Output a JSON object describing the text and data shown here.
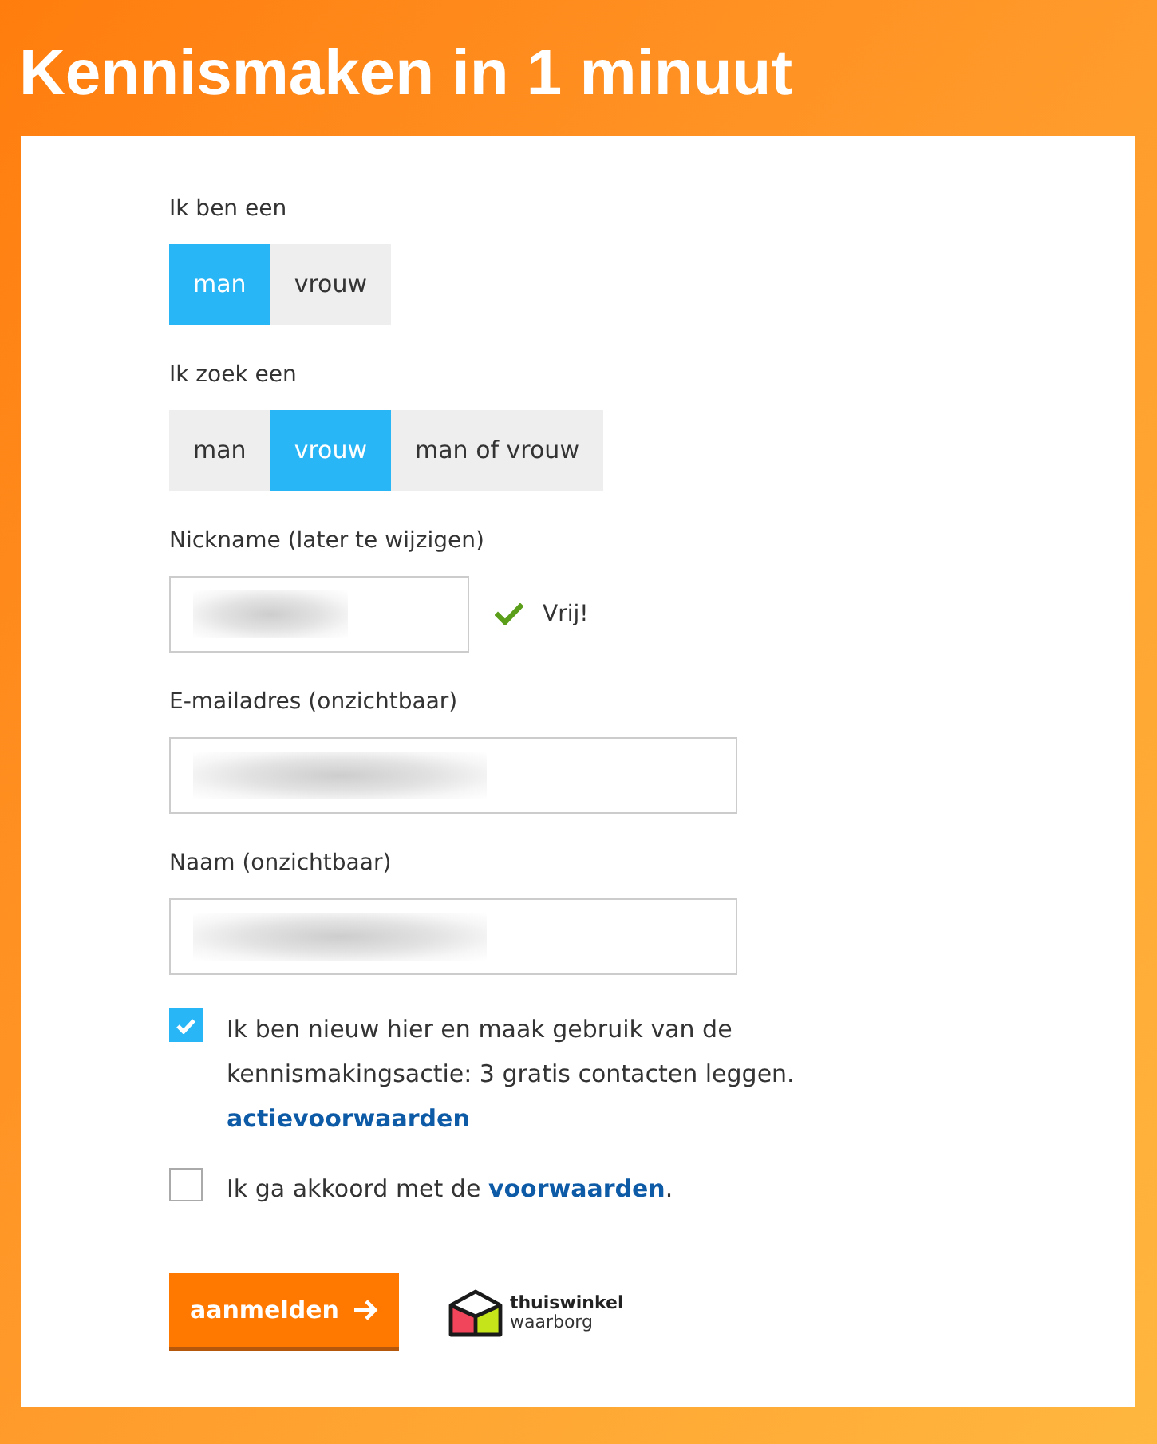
{
  "title": "Kennismaken in 1 minuut",
  "form": {
    "groups": [
      {
        "label": "Ik ben een",
        "options": [
          {
            "label": "man",
            "selected": true
          },
          {
            "label": "vrouw",
            "selected": false
          }
        ]
      },
      {
        "label": "Ik zoek een",
        "options": [
          {
            "label": "man",
            "selected": false
          },
          {
            "label": "vrouw",
            "selected": true
          },
          {
            "label": "man of vrouw",
            "selected": false
          }
        ]
      }
    ],
    "fields": [
      {
        "label": "Nickname (later te wijzigen)",
        "obscured": true,
        "status": {
          "text": "Vrij!",
          "valid": true
        }
      },
      {
        "label": "E-mailadres (onzichtbaar)",
        "obscured": true
      },
      {
        "label": "Naam (onzichtbaar)",
        "obscured": true
      }
    ],
    "checkboxes": [
      {
        "checked": true,
        "text": [
          {
            "kind": "text",
            "text": "Ik ben nieuw hier en maak gebruik van de kennismakingsactie: 3 gratis contacten leggen."
          }
        ],
        "link": "actievoorwaarden"
      },
      {
        "checked": false,
        "text": [
          {
            "kind": "text",
            "text": "Ik ga akkoord met de "
          },
          {
            "kind": "link",
            "text": "voorwaarden"
          },
          {
            "kind": "text",
            "text": "."
          }
        ]
      }
    ],
    "submit_button": {
      "label": "aanmelden"
    },
    "trust_logo": {
      "name": "thuiswinkel",
      "tagline": "waarborg"
    }
  }
}
